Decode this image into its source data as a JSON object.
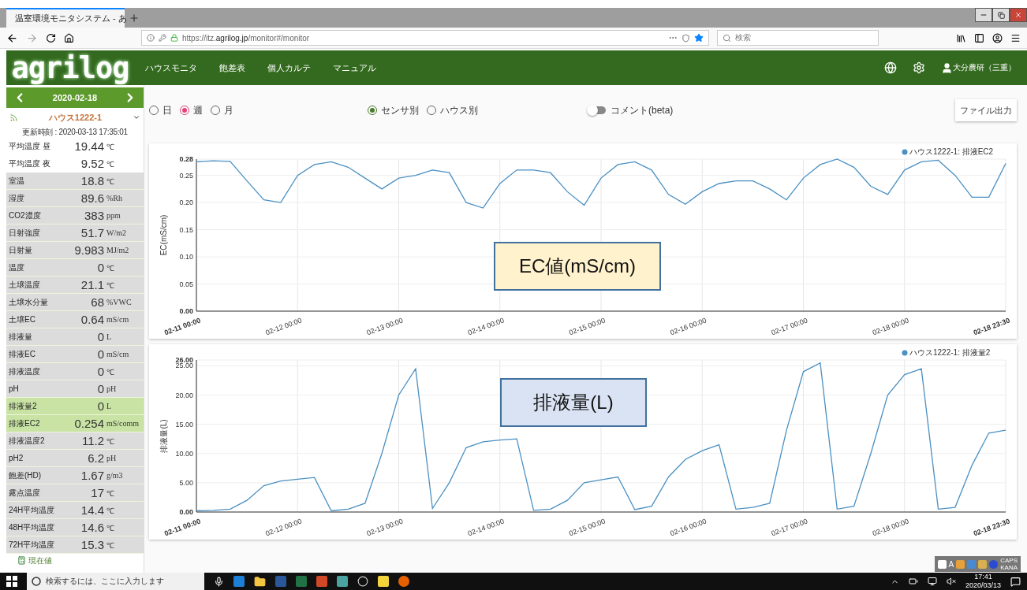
{
  "browser": {
    "tab_title": "温室環境モニタシステム - あ",
    "url_host": "https://itz.",
    "url_domain": "agrilog.jp",
    "url_path": "/monitor#/monitor",
    "search": {
      "placeholder": "検索"
    }
  },
  "header": {
    "logo": "agrilog",
    "nav": [
      "ハウスモニタ",
      "飽差表",
      "個人カルテ",
      "マニュアル"
    ],
    "user": "大分農研（三重）"
  },
  "sidebar": {
    "date": "2020-02-18",
    "house": "ハウス1222-1",
    "updated": "更新時刻 : 2020-03-13 17:35:01",
    "items": [
      {
        "label": "平均温度 昼",
        "value": "19.44",
        "unit": "℃",
        "kind": "average",
        "highlighted": false
      },
      {
        "label": "平均温度 夜",
        "value": "9.52",
        "unit": "℃",
        "kind": "average",
        "highlighted": false
      },
      {
        "label": "室温",
        "value": "18.8",
        "unit": "℃",
        "kind": "sensor",
        "highlighted": false
      },
      {
        "label": "湿度",
        "value": "89.6",
        "unit": "%Rh",
        "kind": "sensor",
        "highlighted": false
      },
      {
        "label": "CO2濃度",
        "value": "383",
        "unit": "ppm",
        "kind": "sensor",
        "highlighted": false
      },
      {
        "label": "日射強度",
        "value": "51.7",
        "unit": "W/m2",
        "kind": "sensor",
        "highlighted": false
      },
      {
        "label": "日射量",
        "value": "9.983",
        "unit": "MJ/m2",
        "kind": "sensor",
        "highlighted": false
      },
      {
        "label": "温度",
        "value": "0",
        "unit": "℃",
        "kind": "sensor",
        "highlighted": false
      },
      {
        "label": "土壌温度",
        "value": "21.1",
        "unit": "℃",
        "kind": "sensor",
        "highlighted": false
      },
      {
        "label": "土壌水分量",
        "value": "68",
        "unit": "%VWC",
        "kind": "sensor",
        "highlighted": false
      },
      {
        "label": "土壌EC",
        "value": "0.64",
        "unit": "mS/cm",
        "kind": "sensor",
        "highlighted": false
      },
      {
        "label": "排液量",
        "value": "0",
        "unit": "L",
        "kind": "sensor",
        "highlighted": false
      },
      {
        "label": "排液EC",
        "value": "0",
        "unit": "mS/cm",
        "kind": "sensor",
        "highlighted": false
      },
      {
        "label": "排液温度",
        "value": "0",
        "unit": "℃",
        "kind": "sensor",
        "highlighted": false
      },
      {
        "label": "pH",
        "value": "0",
        "unit": "pH",
        "kind": "sensor",
        "highlighted": false
      },
      {
        "label": "排液量2",
        "value": "0",
        "unit": "L",
        "kind": "sensor",
        "highlighted": true
      },
      {
        "label": "排液EC2",
        "value": "0.254",
        "unit": "mS/comm",
        "kind": "sensor",
        "highlighted": true
      },
      {
        "label": "排液温度2",
        "value": "11.2",
        "unit": "℃",
        "kind": "sensor",
        "highlighted": false
      },
      {
        "label": "pH2",
        "value": "6.2",
        "unit": "pH",
        "kind": "sensor",
        "highlighted": false
      },
      {
        "label": "飽差(HD)",
        "value": "1.67",
        "unit": "g/m3",
        "kind": "sensor",
        "highlighted": false
      },
      {
        "label": "露点温度",
        "value": "17",
        "unit": "℃",
        "kind": "sensor",
        "highlighted": false
      },
      {
        "label": "24H平均温度",
        "value": "14.4",
        "unit": "℃",
        "kind": "sensor",
        "highlighted": false
      },
      {
        "label": "48H平均温度",
        "value": "14.6",
        "unit": "℃",
        "kind": "sensor",
        "highlighted": false
      },
      {
        "label": "72H平均温度",
        "value": "15.3",
        "unit": "℃",
        "kind": "sensor",
        "highlighted": false
      }
    ],
    "footer": "現在値"
  },
  "toolbar": {
    "period": [
      {
        "label": "日",
        "selected": false
      },
      {
        "label": "週",
        "selected": true
      },
      {
        "label": "月",
        "selected": false
      }
    ],
    "view": [
      {
        "label": "センサ別",
        "selected": true
      },
      {
        "label": "ハウス別",
        "selected": false
      }
    ],
    "comment": {
      "label": "コメント(beta)",
      "on": false
    },
    "export": "ファイル出力"
  },
  "charts": [
    {
      "callout": "EC値(mS/cm)",
      "chart_data": {
        "type": "line",
        "ylabel": "EC(mS/cm)",
        "grid": true,
        "categories": [
          "02-11 00:00",
          null,
          null,
          null,
          null,
          null,
          "02-12 00:00",
          null,
          null,
          null,
          null,
          null,
          "02-13 00:00",
          null,
          null,
          null,
          null,
          null,
          "02-14 00:00",
          null,
          null,
          null,
          null,
          null,
          "02-15 00:00",
          null,
          null,
          null,
          null,
          null,
          "02-16 00:00",
          null,
          null,
          null,
          null,
          null,
          "02-17 00:00",
          null,
          null,
          null,
          null,
          null,
          "02-18 00:00",
          null,
          null,
          null,
          null,
          null,
          "02-18 23:30"
        ],
        "series": [
          {
            "name": "ハウス1222-1: 排液EC2",
            "color": "#4a90c2",
            "values": [
              0.275,
              0.277,
              0.276,
              0.24,
              0.205,
              0.2,
              0.25,
              0.27,
              0.275,
              0.265,
              0.245,
              0.225,
              0.245,
              0.25,
              0.26,
              0.255,
              0.2,
              0.19,
              0.235,
              0.26,
              0.26,
              0.255,
              0.22,
              0.195,
              0.245,
              0.27,
              0.275,
              0.26,
              0.215,
              0.197,
              0.22,
              0.235,
              0.24,
              0.24,
              0.225,
              0.205,
              0.245,
              0.27,
              0.28,
              0.265,
              0.23,
              0.215,
              0.26,
              0.275,
              0.278,
              0.25,
              0.21,
              0.21,
              0.272
            ]
          }
        ],
        "ylim": [
          0,
          0.28
        ],
        "yticks": [
          {
            "value": 0,
            "label": "0.00"
          },
          {
            "value": 0.05,
            "label": "0.05"
          },
          {
            "value": 0.1,
            "label": "0.10"
          },
          {
            "value": 0.15,
            "label": "0.15"
          },
          {
            "value": 0.2,
            "label": "0.20"
          },
          {
            "value": 0.25,
            "label": "0.25"
          },
          {
            "value": 0.28,
            "label": "0.28"
          }
        ]
      }
    },
    {
      "callout": "排液量(L)",
      "chart_data": {
        "type": "line",
        "ylabel": "排液量(L)",
        "grid": true,
        "categories": [
          "02-11 00:00",
          null,
          null,
          null,
          null,
          null,
          "02-12 00:00",
          null,
          null,
          null,
          null,
          null,
          "02-13 00:00",
          null,
          null,
          null,
          null,
          null,
          "02-14 00:00",
          null,
          null,
          null,
          null,
          null,
          "02-15 00:00",
          null,
          null,
          null,
          null,
          null,
          "02-16 00:00",
          null,
          null,
          null,
          null,
          null,
          "02-17 00:00",
          null,
          null,
          null,
          null,
          null,
          "02-18 00:00",
          null,
          null,
          null,
          null,
          null,
          "02-18 23:30"
        ],
        "series": [
          {
            "name": "ハウス1222-1: 排液量2",
            "color": "#4a90c2",
            "values": [
              0.2,
              0.3,
              0.5,
              2,
              4.5,
              5.3,
              5.6,
              5.9,
              0.2,
              0.5,
              1.5,
              10,
              20,
              24.5,
              0.6,
              5,
              11,
              12,
              12.3,
              12.5,
              0.3,
              0.5,
              2,
              5,
              5.5,
              6,
              0.4,
              1,
              6,
              9,
              10.5,
              11.5,
              0.5,
              0.8,
              1.5,
              14,
              24,
              25.5,
              0.5,
              1,
              10,
              20,
              23.5,
              24.5,
              0.5,
              0.8,
              8,
              13.5,
              14
            ]
          }
        ],
        "ylim": [
          0,
          26
        ],
        "yticks": [
          {
            "value": 0,
            "label": "0.00"
          },
          {
            "value": 5,
            "label": "5.00"
          },
          {
            "value": 10,
            "label": "10.00"
          },
          {
            "value": 15,
            "label": "15.00"
          },
          {
            "value": 20,
            "label": "20.00"
          },
          {
            "value": 25,
            "label": "25.00"
          },
          {
            "value": 26,
            "label": "26.00"
          }
        ]
      }
    }
  ],
  "ime": {
    "letter": "A",
    "caps": "CAPS",
    "kana": "KANA"
  },
  "taskbar": {
    "search": {
      "placeholder": "検索するには、ここに入力します"
    },
    "time": "17:41",
    "date": "2020/03/13"
  }
}
